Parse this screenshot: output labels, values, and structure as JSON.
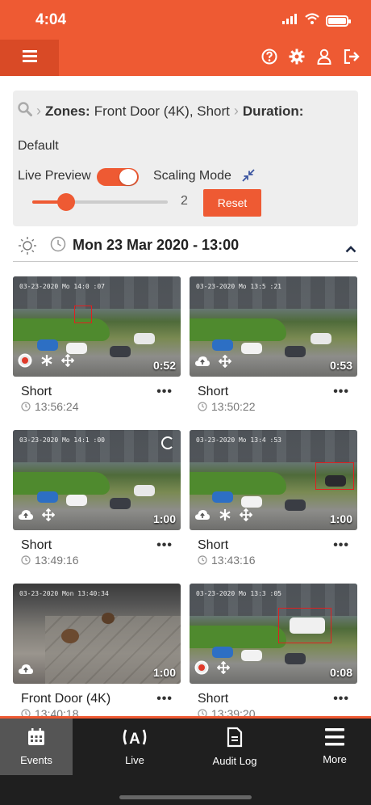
{
  "status_bar": {
    "time": "4:04"
  },
  "header": {
    "menu_icon": "hamburger-icon",
    "icons": [
      "help-icon",
      "gear-icon",
      "user-icon",
      "logout-icon"
    ]
  },
  "filter": {
    "zones_label": "Zones:",
    "zones_value": "Front Door (4K), Short",
    "duration_label": "Duration:",
    "duration_value": "Default",
    "live_preview_label": "Live Preview",
    "live_preview_on": true,
    "scaling_mode_label": "Scaling Mode",
    "slider_value": "2",
    "reset_label": "Reset"
  },
  "date_header": {
    "text": "Mon 23 Mar 2020 - 13:00"
  },
  "events": [
    {
      "title": "Short",
      "time": "13:56:24",
      "duration": "0:52",
      "timestamp": "03-23-2020 Mo 14:0 :07",
      "icons": [
        "alert-icon",
        "asterisk-icon",
        "move-icon"
      ]
    },
    {
      "title": "Short",
      "time": "13:50:22",
      "duration": "0:53",
      "timestamp": "03-23-2020 Mo 13:5 :21",
      "icons": [
        "cloud-upload-icon",
        "move-icon"
      ]
    },
    {
      "title": "Short",
      "time": "13:49:16",
      "duration": "1:00",
      "timestamp": "03-23-2020 Mo 14:1 :00",
      "icons": [
        "cloud-upload-icon",
        "move-icon"
      ]
    },
    {
      "title": "Short",
      "time": "13:43:16",
      "duration": "1:00",
      "timestamp": "03-23-2020 Mo 13:4 :53",
      "icons": [
        "cloud-upload-icon",
        "asterisk-icon",
        "move-icon"
      ]
    },
    {
      "title": "Front Door (4K)",
      "time": "13:40:18",
      "duration": "1:00",
      "timestamp": "03-23-2020 Mon 13:40:34",
      "icons": [
        "cloud-upload-icon"
      ]
    },
    {
      "title": "Short",
      "time": "13:39:20",
      "duration": "0:08",
      "timestamp": "03-23-2020 Mo 13:3 :05",
      "icons": [
        "alert-icon",
        "move-icon"
      ]
    }
  ],
  "tabs": [
    {
      "label": "Events",
      "icon": "calendar-icon",
      "active": true
    },
    {
      "label": "Live",
      "icon": "live-broadcast-icon",
      "active": false
    },
    {
      "label": "Audit Log",
      "icon": "document-icon",
      "active": false
    },
    {
      "label": "More",
      "icon": "menu-icon",
      "active": false
    }
  ],
  "colors": {
    "accent": "#ee5a33",
    "tabbar": "#1f1f1f",
    "panel": "#eeeeee"
  }
}
